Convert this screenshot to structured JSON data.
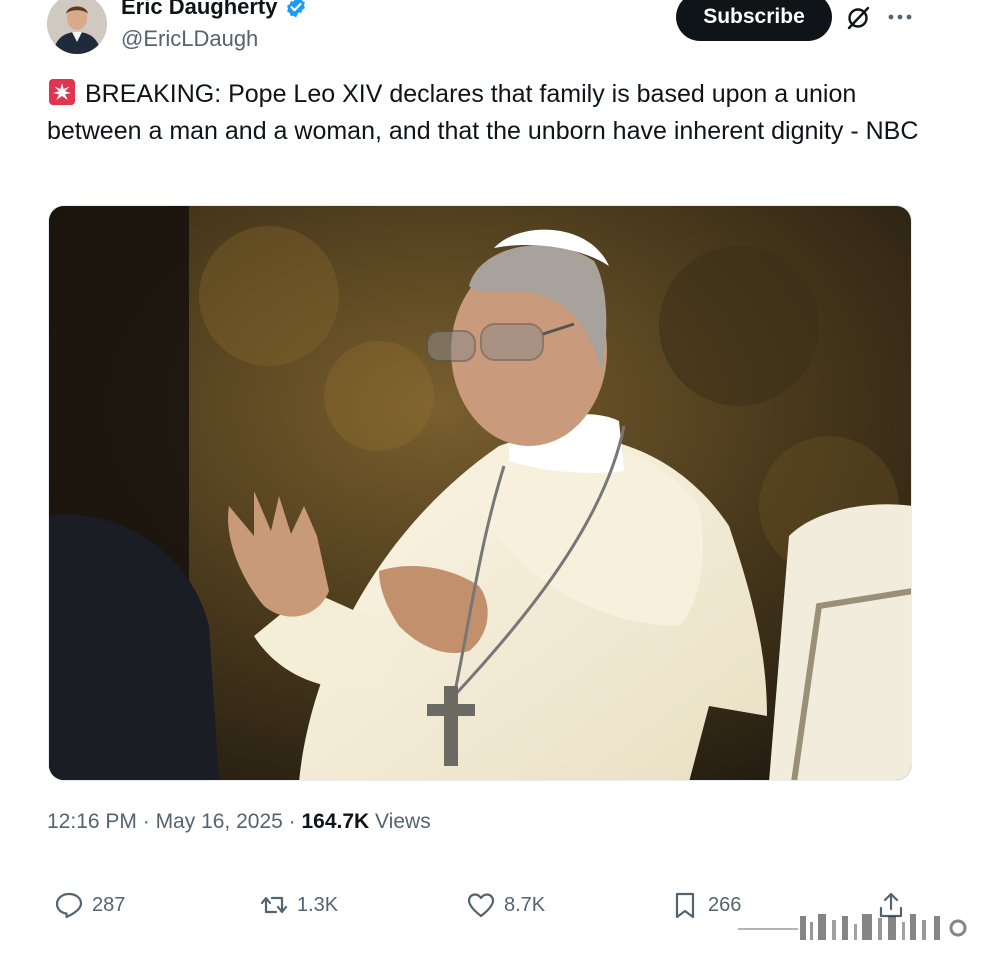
{
  "author": {
    "name": "Eric Daugherty",
    "handle": "@EricLDaugh",
    "verified_icon": "verified-badge-icon",
    "avatar_icon": "avatar"
  },
  "header": {
    "subscribe_label": "Subscribe",
    "grok_icon": "grok-icon",
    "more_icon": "more-dots-icon"
  },
  "tweet": {
    "emoji_icon": "police-siren-icon",
    "text": "BREAKING: Pope Leo XIV declares that family is based upon a union between a man and a woman, and that the unborn have inherent dignity - NBC",
    "image_description_icon": "tweet-photo"
  },
  "meta": {
    "time": "12:16 PM",
    "separator": " · ",
    "date": "May 16, 2025",
    "views_count": "164.7K",
    "views_label": " Views"
  },
  "actions": {
    "replies": "287",
    "retweets": "1.3K",
    "likes": "8.7K",
    "bookmarks": "266"
  },
  "colors": {
    "accent": "#1d9bf0",
    "text_primary": "#0f1419",
    "text_secondary": "#536471"
  }
}
